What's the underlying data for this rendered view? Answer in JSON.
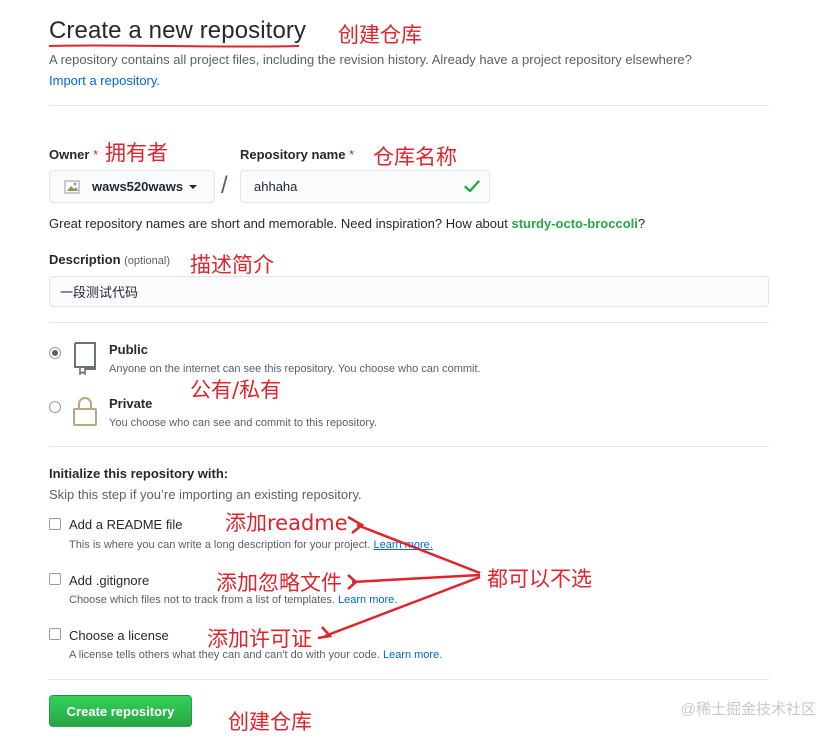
{
  "header": {
    "title": "Create a new repository",
    "subtitle": "A repository contains all project files, including the revision history. Already have a project repository elsewhere?",
    "import_link": "Import a repository."
  },
  "owner": {
    "label": "Owner",
    "required_mark": "*",
    "value": "waws520waws"
  },
  "repo_name": {
    "label": "Repository name",
    "required_mark": "*",
    "value": "ahhaha",
    "hint_prefix": "Great repository names are short and memorable. Need inspiration? How about ",
    "suggestion": "sturdy-octo-broccoli",
    "hint_suffix": "?"
  },
  "description": {
    "label": "Description",
    "optional": "(optional)",
    "value": "一段测试代码"
  },
  "visibility": {
    "selected": "public",
    "options": [
      {
        "title": "Public",
        "desc": "Anyone on the internet can see this repository. You choose who can commit."
      },
      {
        "title": "Private",
        "desc": "You choose who can see and commit to this repository."
      }
    ]
  },
  "init": {
    "title": "Initialize this repository with:",
    "subtitle": "Skip this step if you’re importing an existing repository.",
    "options": [
      {
        "title": "Add a README file",
        "desc": "This is where you can write a long description for your project.",
        "link": "Learn more."
      },
      {
        "title": "Add .gitignore",
        "desc": "Choose which files not to track from a list of templates.",
        "link": "Learn more."
      },
      {
        "title": "Choose a license",
        "desc": "A license tells others what they can and can't do with your code.",
        "link": "Learn more."
      }
    ]
  },
  "submit_label": "Create repository",
  "annotations": {
    "create_repo_title": "创建仓库",
    "owner": "拥有者",
    "repo_name": "仓库名称",
    "description": "描述简介",
    "visibility": "公有/私有",
    "readme": "添加readme",
    "gitignore": "添加忽略文件",
    "license": "添加许可证",
    "optional_all": "都可以不选",
    "create_button": "创建仓库"
  },
  "watermark": "@稀土掘金技术社区",
  "colors": {
    "annotation_red": "#e0232c",
    "success_green": "#28a745",
    "link_blue": "#0366d6"
  }
}
